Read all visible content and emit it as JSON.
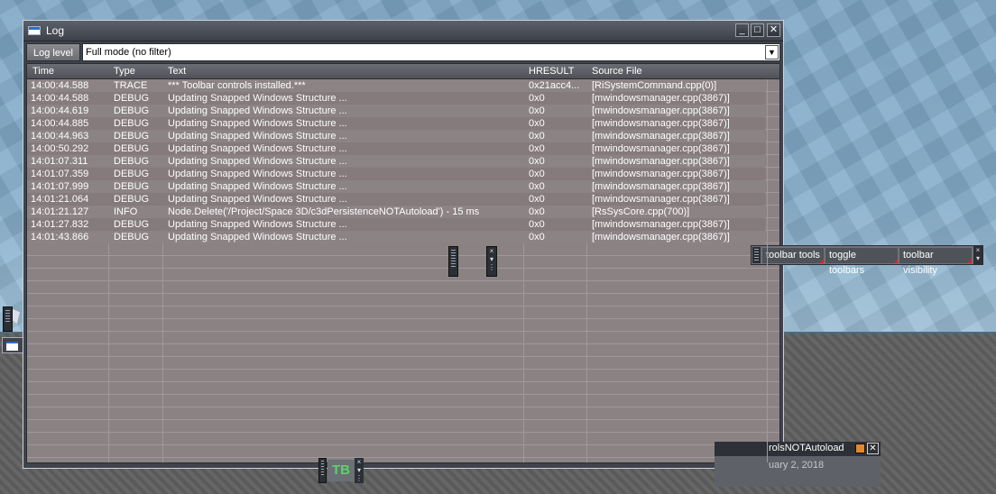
{
  "window": {
    "title": "Log",
    "buttons": {
      "minimize": "_",
      "maximize": "□",
      "close": "✕"
    }
  },
  "filter": {
    "label": "Log level",
    "selected": "Full mode  (no filter)"
  },
  "table": {
    "columns": [
      "Time",
      "Type",
      "Text",
      "HRESULT",
      "Source File"
    ],
    "rows": [
      [
        "14:00:44.588",
        "TRACE",
        "*** Toolbar controls installed.***",
        "0x21acc4...",
        "[RiSystemCommand.cpp(0)]"
      ],
      [
        "14:00:44.588",
        "DEBUG",
        "Updating Snapped Windows Structure ...",
        "0x0",
        "[mwindowsmanager.cpp(3867)]"
      ],
      [
        "14:00:44.619",
        "DEBUG",
        "Updating Snapped Windows Structure ...",
        "0x0",
        "[mwindowsmanager.cpp(3867)]"
      ],
      [
        "14:00:44.885",
        "DEBUG",
        "Updating Snapped Windows Structure ...",
        "0x0",
        "[mwindowsmanager.cpp(3867)]"
      ],
      [
        "14:00:44.963",
        "DEBUG",
        "Updating Snapped Windows Structure ...",
        "0x0",
        "[mwindowsmanager.cpp(3867)]"
      ],
      [
        "14:00:50.292",
        "DEBUG",
        "Updating Snapped Windows Structure ...",
        "0x0",
        "[mwindowsmanager.cpp(3867)]"
      ],
      [
        "14:01:07.311",
        "DEBUG",
        "Updating Snapped Windows Structure ...",
        "0x0",
        "[mwindowsmanager.cpp(3867)]"
      ],
      [
        "14:01:07.359",
        "DEBUG",
        "Updating Snapped Windows Structure ...",
        "0x0",
        "[mwindowsmanager.cpp(3867)]"
      ],
      [
        "14:01:07.999",
        "DEBUG",
        "Updating Snapped Windows Structure ...",
        "0x0",
        "[mwindowsmanager.cpp(3867)]"
      ],
      [
        "14:01:21.064",
        "DEBUG",
        "Updating Snapped Windows Structure ...",
        "0x0",
        "[mwindowsmanager.cpp(3867)]"
      ],
      [
        "14:01:21.127",
        "INFO",
        "Node.Delete('/Project/Space 3D/c3dPersistenceNOTAutoload') - 15 ms",
        "0x0",
        "[RsSysCore.cpp(700)]"
      ],
      [
        "14:01:27.832",
        "DEBUG",
        "Updating Snapped Windows Structure ...",
        "0x0",
        "[mwindowsmanager.cpp(3867)]"
      ],
      [
        "14:01:43.866",
        "DEBUG",
        "Updating Snapped Windows Structure ...",
        "0x0",
        "[mwindowsmanager.cpp(3867)]"
      ]
    ]
  },
  "toolbar_right": {
    "items": [
      "toolbar tools",
      "toggle toolbars",
      "toolbar visibility"
    ]
  },
  "toolbar_bottom": {
    "button": "TB"
  },
  "notification": {
    "title": "rolsNOTAutoload",
    "date": "uary 2, 2018"
  }
}
